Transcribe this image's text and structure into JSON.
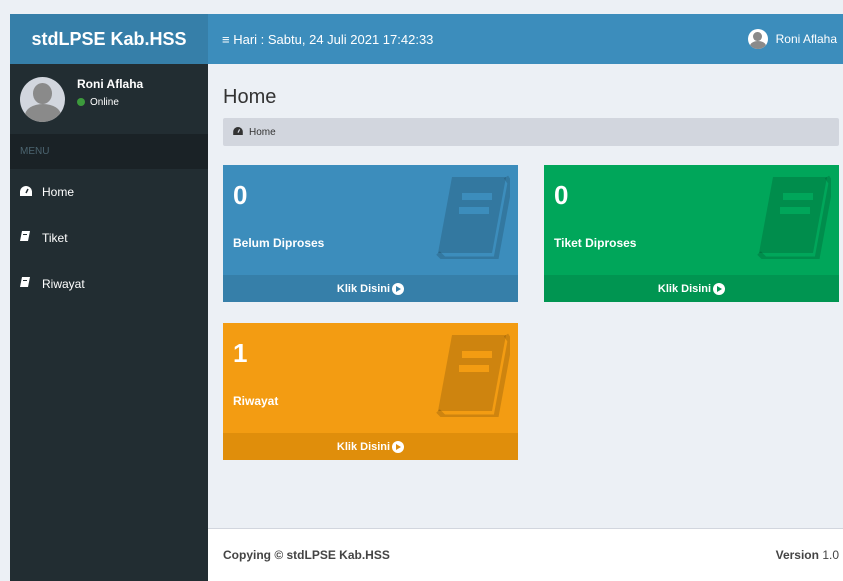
{
  "app": {
    "name": "stdLPSE Kab.HSS"
  },
  "topbar": {
    "date": "Hari : Sabtu, 24 Juli 2021 17:42:33",
    "menu_icon": "≡",
    "user_name": "Roni Aflaha"
  },
  "sidebar": {
    "user": {
      "name": "Roni Aflaha",
      "status": "Online"
    },
    "menu_header": "MENU",
    "items": [
      {
        "label": "Home",
        "icon": "dashboard-icon"
      },
      {
        "label": "Tiket",
        "icon": "book-icon"
      },
      {
        "label": "Riwayat",
        "icon": "book-icon"
      }
    ]
  },
  "page": {
    "title": "Home",
    "breadcrumb": "Home"
  },
  "boxes": [
    {
      "number": "0",
      "label": "Belum Diproses",
      "link": "Klik Disini",
      "color": "#3c8dbc"
    },
    {
      "number": "0",
      "label": "Tiket Diproses",
      "link": "Klik Disini",
      "color": "#00a65a"
    },
    {
      "number": "1",
      "label": "Riwayat",
      "link": "Klik Disini",
      "color": "#f39c12"
    }
  ],
  "footer": {
    "copy": "Copying © stdLPSE Kab.HSS",
    "version_label": "Version",
    "version_number": "1.0"
  }
}
